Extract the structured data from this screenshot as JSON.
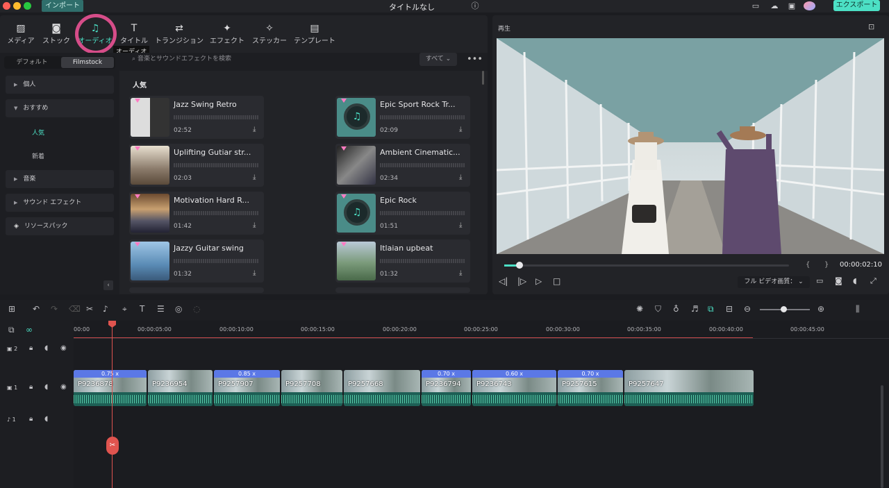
{
  "app": {
    "import_label": "インポート",
    "title": "タイトルなし",
    "export_label": "エクスポート"
  },
  "toolbar": {
    "items": [
      {
        "label": "メディア",
        "icon": "media-icon"
      },
      {
        "label": "ストック",
        "icon": "stock-icon"
      },
      {
        "label": "オーディオ",
        "icon": "music-note-icon"
      },
      {
        "label": "タイトル",
        "icon": "text-icon"
      },
      {
        "label": "トランジション",
        "icon": "transition-icon"
      },
      {
        "label": "エフェクト",
        "icon": "effect-icon"
      },
      {
        "label": "ステッカー",
        "icon": "sticker-icon"
      },
      {
        "label": "テンプレート",
        "icon": "template-icon"
      }
    ],
    "tooltip": "オーディオ",
    "active": "オーディオ"
  },
  "source_tabs": {
    "default_label": "デフォルト",
    "filmstock_label": "Filmstock"
  },
  "search": {
    "placeholder": "音楽とサウンドエフェクトを検索"
  },
  "filter": {
    "label": "すべて"
  },
  "sidebar": {
    "items": [
      {
        "label": "個人"
      },
      {
        "label": "おすすめ"
      },
      {
        "label": "音楽"
      },
      {
        "label": "サウンド エフェクト"
      },
      {
        "label": "リソースパック"
      }
    ],
    "sub_items": [
      {
        "label": "人気"
      },
      {
        "label": "新着"
      }
    ]
  },
  "library": {
    "section_title": "人気",
    "tracks": [
      {
        "title": "Jazz Swing Retro",
        "duration": "02:52"
      },
      {
        "title": "Epic Sport Rock Tr...",
        "duration": "02:09"
      },
      {
        "title": "Uplifting Gutiar str...",
        "duration": "02:03"
      },
      {
        "title": "Ambient Cinematic...",
        "duration": "02:34"
      },
      {
        "title": "Motivation Hard R...",
        "duration": "01:42"
      },
      {
        "title": "Epic Rock",
        "duration": "01:51"
      },
      {
        "title": "Jazzy Guitar swing",
        "duration": "01:32"
      },
      {
        "title": "Itlaian upbeat",
        "duration": "01:32"
      }
    ]
  },
  "preview": {
    "label": "再生",
    "timecode": "00:00:02:10",
    "quality": "フル ビデオ画質：",
    "progress": 0.05
  },
  "timeline": {
    "ruler": [
      "00:00",
      "00:00:05:00",
      "00:00:10:00",
      "00:00:15:00",
      "00:00:20:00",
      "00:00:25:00",
      "00:00:30:00",
      "00:00:35:00",
      "00:00:40:00",
      "00:00:45:00"
    ],
    "tracks": [
      {
        "label": "2"
      },
      {
        "label": "1"
      },
      {
        "label": "1"
      }
    ],
    "clips": [
      {
        "name": "P9236878",
        "speed": "0.75 x"
      },
      {
        "name": "P9236954",
        "speed": ""
      },
      {
        "name": "P9257907",
        "speed": "0.85 x"
      },
      {
        "name": "P9257708",
        "speed": ""
      },
      {
        "name": "P9257668",
        "speed": ""
      },
      {
        "name": "P9236794",
        "speed": "0.70 x"
      },
      {
        "name": "P9236743",
        "speed": "0.60 x"
      },
      {
        "name": "P9257615",
        "speed": "0.70 x"
      },
      {
        "name": "P9257647",
        "speed": ""
      }
    ]
  },
  "colors": {
    "accent": "#4ce0c5",
    "highlight": "#d64d89",
    "playhead": "#e0544f",
    "speed": "#5b78e6"
  }
}
